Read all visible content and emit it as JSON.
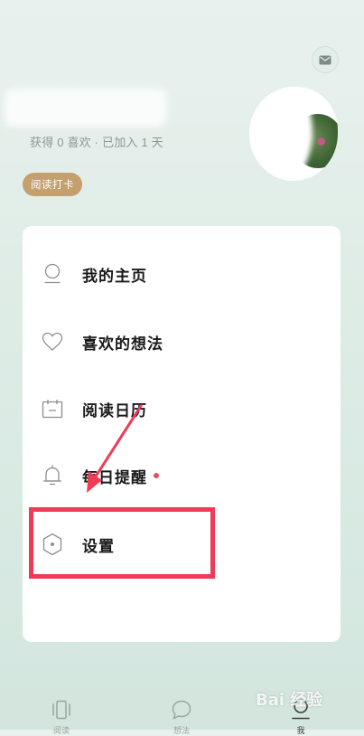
{
  "header": {
    "stats": "获得 0 喜欢 · 已加入 1 天",
    "read_checkin": "阅读打卡",
    "message_icon": "mail-icon"
  },
  "menu": {
    "items": [
      {
        "label": "我的主页",
        "icon": "person-icon"
      },
      {
        "label": "喜欢的想法",
        "icon": "heart-icon"
      },
      {
        "label": "阅读日历",
        "icon": "calendar-icon"
      },
      {
        "label": "每日提醒",
        "icon": "bell-icon",
        "badge_color": "#e0505a"
      },
      {
        "label": "设置",
        "icon": "hexagon-settings-icon"
      }
    ]
  },
  "bottom_nav": {
    "items": [
      {
        "label": "阅读",
        "icon": "cards-icon"
      },
      {
        "label": "想法",
        "icon": "chat-bubble-icon"
      },
      {
        "label": "我",
        "icon": "profile-icon",
        "active": true
      }
    ]
  },
  "overlay": {
    "highlight_color": "#f03a57",
    "watermark": "Bai 经验"
  }
}
